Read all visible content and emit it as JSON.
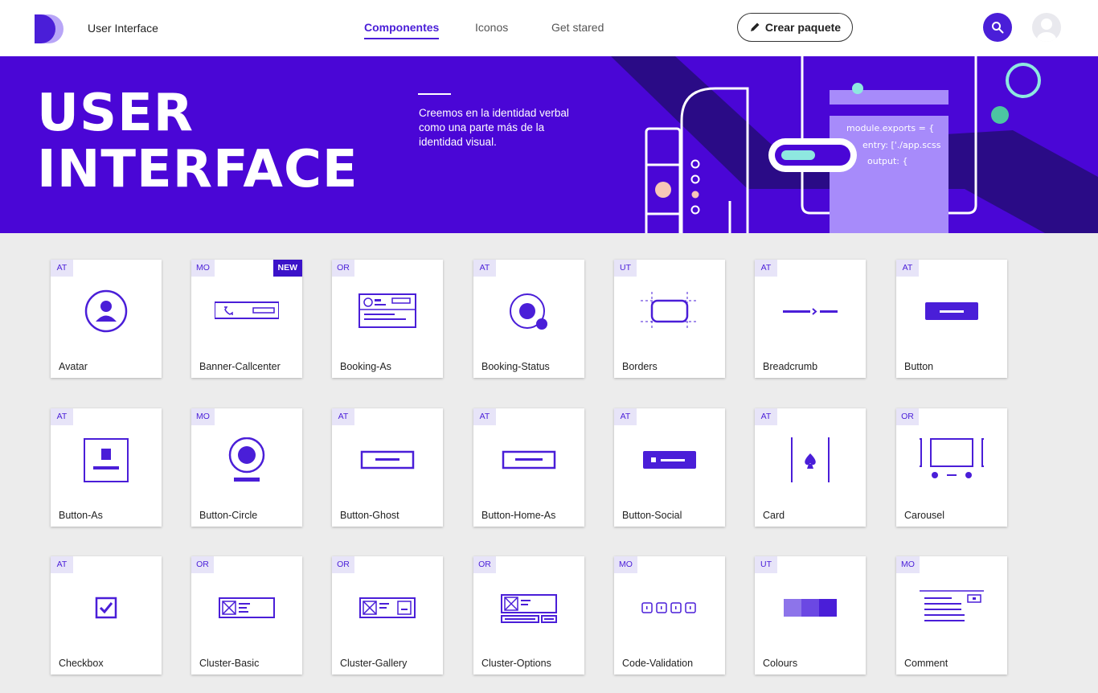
{
  "header": {
    "app_title": "User Interface",
    "nav": [
      {
        "label": "Componentes",
        "active": true
      },
      {
        "label": "Iconos",
        "active": false
      },
      {
        "label": "Get stared",
        "active": false
      }
    ],
    "create_button": "Crear paquete",
    "icons": [
      "logo-icon",
      "pencil-icon",
      "search-icon",
      "user-avatar-icon"
    ]
  },
  "hero": {
    "title_line1": "USER",
    "title_line2": "INTERFACE",
    "description": "Creemos en la identidad verbal como una parte más de la identidad visual.",
    "code_lines": [
      "module.exports = {",
      "entry: ['./app.scss",
      "output: {"
    ]
  },
  "colors": {
    "brand": "#4a06d6",
    "accent": "#4a1ed8",
    "tag_bg": "#e7e4f8",
    "new_badge": "#3b12c9"
  },
  "components": [
    {
      "tag": "AT",
      "name": "Avatar",
      "icon": "avatar-icon"
    },
    {
      "tag": "MO",
      "name": "Banner-Callcenter",
      "icon": "banner-callcenter-icon",
      "badge": "NEW"
    },
    {
      "tag": "OR",
      "name": "Booking-As",
      "icon": "booking-as-icon"
    },
    {
      "tag": "AT",
      "name": "Booking-Status",
      "icon": "booking-status-icon"
    },
    {
      "tag": "UT",
      "name": "Borders",
      "icon": "borders-icon"
    },
    {
      "tag": "AT",
      "name": "Breadcrumb",
      "icon": "breadcrumb-icon"
    },
    {
      "tag": "AT",
      "name": "Button",
      "icon": "button-icon"
    },
    {
      "tag": "AT",
      "name": "Button-As",
      "icon": "button-as-icon"
    },
    {
      "tag": "MO",
      "name": "Button-Circle",
      "icon": "button-circle-icon"
    },
    {
      "tag": "AT",
      "name": "Button-Ghost",
      "icon": "button-ghost-icon"
    },
    {
      "tag": "AT",
      "name": "Button-Home-As",
      "icon": "button-home-as-icon"
    },
    {
      "tag": "AT",
      "name": "Button-Social",
      "icon": "button-social-icon"
    },
    {
      "tag": "AT",
      "name": "Card",
      "icon": "card-icon"
    },
    {
      "tag": "OR",
      "name": "Carousel",
      "icon": "carousel-icon"
    },
    {
      "tag": "AT",
      "name": "Checkbox",
      "icon": "checkbox-icon"
    },
    {
      "tag": "OR",
      "name": "Cluster-Basic",
      "icon": "cluster-basic-icon"
    },
    {
      "tag": "OR",
      "name": "Cluster-Gallery",
      "icon": "cluster-gallery-icon"
    },
    {
      "tag": "OR",
      "name": "Cluster-Options",
      "icon": "cluster-options-icon"
    },
    {
      "tag": "MO",
      "name": "Code-Validation",
      "icon": "code-validation-icon"
    },
    {
      "tag": "UT",
      "name": "Colours",
      "icon": "colours-icon"
    },
    {
      "tag": "MO",
      "name": "Comment",
      "icon": "comment-icon"
    }
  ]
}
